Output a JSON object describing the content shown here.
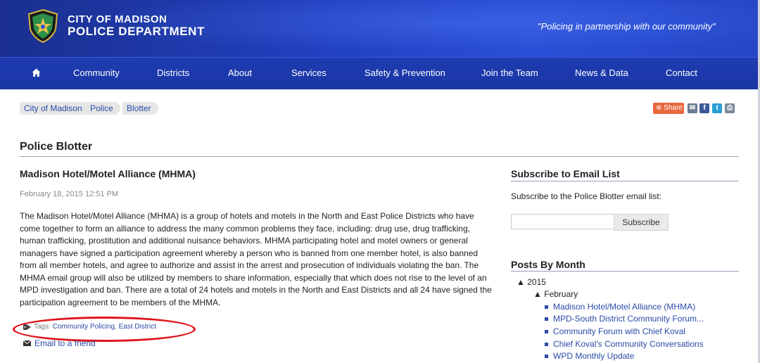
{
  "header": {
    "brand_top": "CITY OF MADISON",
    "brand_bottom": "POLICE DEPARTMENT",
    "tagline": "\"Policing in partnership with our community\""
  },
  "nav": {
    "home_icon": "home-icon",
    "items": [
      "Community",
      "Districts",
      "About",
      "Services",
      "Safety & Prevention",
      "Join the Team",
      "News & Data",
      "Contact"
    ]
  },
  "breadcrumb": [
    "City of Madison",
    "Police",
    "Blotter"
  ],
  "share": {
    "label": "Share",
    "icons": [
      "email-icon",
      "facebook-icon",
      "twitter-icon",
      "print-icon"
    ]
  },
  "page_title": "Police Blotter",
  "post": {
    "title": "Madison Hotel/Motel Alliance (MHMA)",
    "date": "February 18, 2015 12:51 PM",
    "body": "The Madison Hotel/Motel Alliance (MHMA) is a group of hotels and motels in the North and East Police Districts who have come together to form an alliance to address the many common problems they face, including: drug use, drug trafficking, human trafficking, prostitution and additional nuisance behaviors.  MHMA participating hotel and motel owners or general managers have signed a participation agreement whereby a person who is banned from one member hotel, is also banned from all member hotels, and agree to authorize and assist in the arrest and prosecution of individuals violating the ban.  The MHMA email group will also be utilized by members to share information, especially that which does not rise to the level of an MPD investigation and ban.  There are a total of 24 hotels and motels in the North and East Districts and all 24 have signed the participation agreement to be members of the MHMA.",
    "tags_label": "Tags:",
    "tags": [
      "Community Policing",
      "East District"
    ],
    "email_friend": "Email to a friend"
  },
  "sidebar": {
    "subscribe_title": "Subscribe to Email List",
    "subscribe_text": "Subscribe to the Police Blotter email list:",
    "subscribe_button": "Subscribe",
    "posts_title": "Posts By Month",
    "year": "2015",
    "month": "February",
    "posts": [
      "Madison Hotel/Motel Alliance (MHMA)",
      "MPD-South District Community Forum...",
      "Community Forum with Chief Koval",
      "Chief Koval's Community Conversations",
      "WPD Monthly Update"
    ]
  },
  "colors": {
    "header_blue": "#2242c4",
    "nav_blue": "#1a37a6",
    "link_blue": "#2a4aa8",
    "share_orange": "#e8673c",
    "annotation_red": "#e0121b"
  }
}
